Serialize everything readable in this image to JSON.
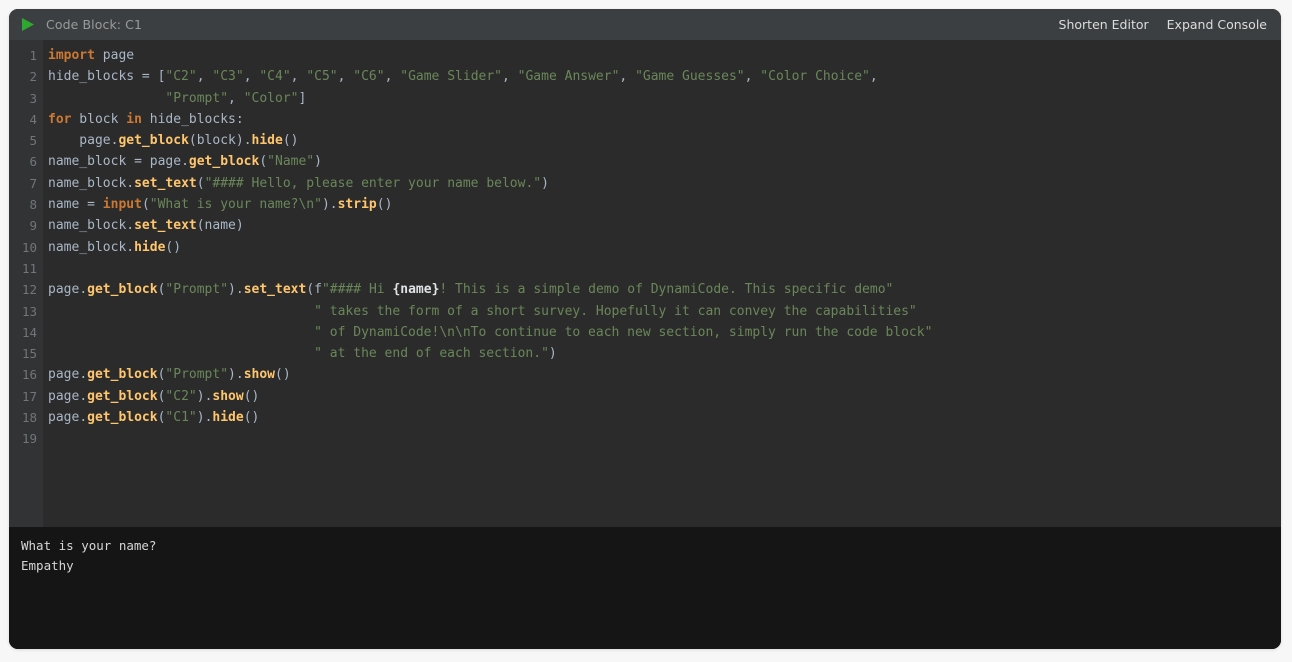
{
  "header": {
    "run_icon": "play-icon",
    "title": "Code Block: C1",
    "actions": [
      {
        "label": "Shorten Editor",
        "name": "shorten-editor-button"
      },
      {
        "label": "Expand Console",
        "name": "expand-console-button"
      }
    ]
  },
  "editor": {
    "line_numbers": [
      "1",
      "2",
      "3",
      "4",
      "5",
      "6",
      "7",
      "8",
      "9",
      "10",
      "11",
      "12",
      "13",
      "14",
      "15",
      "16",
      "17",
      "18",
      "19"
    ],
    "lines": [
      "import page",
      "hide_blocks = [\"C2\", \"C3\", \"C4\", \"C5\", \"C6\", \"Game Slider\", \"Game Answer\", \"Game Guesses\", \"Color Choice\",",
      "               \"Prompt\", \"Color\"]",
      "for block in hide_blocks:",
      "    page.get_block(block).hide()",
      "name_block = page.get_block(\"Name\")",
      "name_block.set_text(\"#### Hello, please enter your name below.\")",
      "name = input(\"What is your name?\\n\").strip()",
      "name_block.set_text(name)",
      "name_block.hide()",
      "",
      "page.get_block(\"Prompt\").set_text(f\"#### Hi {name}! This is a simple demo of DynamiCode. This specific demo\"",
      "                                  \" takes the form of a short survey. Hopefully it can convey the capabilities\"",
      "                                  \" of DynamiCode!\\n\\nTo continue to each new section, simply run the code block\"",
      "                                  \" at the end of each section.\")",
      "page.get_block(\"Prompt\").show()",
      "page.get_block(\"C2\").show()",
      "page.get_block(\"C1\").hide()",
      ""
    ],
    "tokens": [
      [
        [
          "import",
          "kw"
        ],
        [
          " ",
          "punc"
        ],
        [
          "page",
          "id"
        ]
      ],
      [
        [
          "hide_blocks",
          "id"
        ],
        [
          " = [",
          "punc"
        ],
        [
          "\"C2\"",
          "str"
        ],
        [
          ", ",
          "punc"
        ],
        [
          "\"C3\"",
          "str"
        ],
        [
          ", ",
          "punc"
        ],
        [
          "\"C4\"",
          "str"
        ],
        [
          ", ",
          "punc"
        ],
        [
          "\"C5\"",
          "str"
        ],
        [
          ", ",
          "punc"
        ],
        [
          "\"C6\"",
          "str"
        ],
        [
          ", ",
          "punc"
        ],
        [
          "\"Game Slider\"",
          "str"
        ],
        [
          ", ",
          "punc"
        ],
        [
          "\"Game Answer\"",
          "str"
        ],
        [
          ", ",
          "punc"
        ],
        [
          "\"Game Guesses\"",
          "str"
        ],
        [
          ", ",
          "punc"
        ],
        [
          "\"Color Choice\"",
          "str"
        ],
        [
          ",",
          "punc"
        ]
      ],
      [
        [
          "               ",
          "punc"
        ],
        [
          "\"Prompt\"",
          "str"
        ],
        [
          ", ",
          "punc"
        ],
        [
          "\"Color\"",
          "str"
        ],
        [
          "]",
          "punc"
        ]
      ],
      [
        [
          "for",
          "kw"
        ],
        [
          " block ",
          "id"
        ],
        [
          "in",
          "kw"
        ],
        [
          " hide_blocks:",
          "id"
        ]
      ],
      [
        [
          "    page",
          "id"
        ],
        [
          ".",
          "punc"
        ],
        [
          "get_block",
          "fn"
        ],
        [
          "(block)",
          "punc"
        ],
        [
          ".",
          "punc"
        ],
        [
          "hide",
          "fn"
        ],
        [
          "()",
          "punc"
        ]
      ],
      [
        [
          "name_block = page",
          "id"
        ],
        [
          ".",
          "punc"
        ],
        [
          "get_block",
          "fn"
        ],
        [
          "(",
          "punc"
        ],
        [
          "\"Name\"",
          "str"
        ],
        [
          ")",
          "punc"
        ]
      ],
      [
        [
          "name_block",
          "id"
        ],
        [
          ".",
          "punc"
        ],
        [
          "set_text",
          "fn"
        ],
        [
          "(",
          "punc"
        ],
        [
          "\"#### Hello, please enter your name below.\"",
          "str"
        ],
        [
          ")",
          "punc"
        ]
      ],
      [
        [
          "name = ",
          "id"
        ],
        [
          "input",
          "bi"
        ],
        [
          "(",
          "punc"
        ],
        [
          "\"What is your name?\\n\"",
          "str"
        ],
        [
          ")",
          "punc"
        ],
        [
          ".",
          "punc"
        ],
        [
          "strip",
          "fn"
        ],
        [
          "()",
          "punc"
        ]
      ],
      [
        [
          "name_block",
          "id"
        ],
        [
          ".",
          "punc"
        ],
        [
          "set_text",
          "fn"
        ],
        [
          "(name)",
          "punc"
        ]
      ],
      [
        [
          "name_block",
          "id"
        ],
        [
          ".",
          "punc"
        ],
        [
          "hide",
          "fn"
        ],
        [
          "()",
          "punc"
        ]
      ],
      [],
      [
        [
          "page",
          "id"
        ],
        [
          ".",
          "punc"
        ],
        [
          "get_block",
          "fn"
        ],
        [
          "(",
          "punc"
        ],
        [
          "\"Prompt\"",
          "str"
        ],
        [
          ")",
          "punc"
        ],
        [
          ".",
          "punc"
        ],
        [
          "set_text",
          "fn"
        ],
        [
          "(",
          "punc"
        ],
        [
          "f",
          "fpfx"
        ],
        [
          "\"#### Hi ",
          "str"
        ],
        [
          "{name}",
          "fexp"
        ],
        [
          "! This is a simple demo of DynamiCode. This specific demo\"",
          "str"
        ]
      ],
      [
        [
          "                                  ",
          "punc"
        ],
        [
          "\" takes the form of a short survey. Hopefully it can convey the capabilities\"",
          "str"
        ]
      ],
      [
        [
          "                                  ",
          "punc"
        ],
        [
          "\" of DynamiCode!\\n\\nTo continue to each new section, simply run the code block\"",
          "str"
        ]
      ],
      [
        [
          "                                  ",
          "punc"
        ],
        [
          "\" at the end of each section.\"",
          "str"
        ],
        [
          ")",
          "punc"
        ]
      ],
      [
        [
          "page",
          "id"
        ],
        [
          ".",
          "punc"
        ],
        [
          "get_block",
          "fn"
        ],
        [
          "(",
          "punc"
        ],
        [
          "\"Prompt\"",
          "str"
        ],
        [
          ")",
          "punc"
        ],
        [
          ".",
          "punc"
        ],
        [
          "show",
          "fn"
        ],
        [
          "()",
          "punc"
        ]
      ],
      [
        [
          "page",
          "id"
        ],
        [
          ".",
          "punc"
        ],
        [
          "get_block",
          "fn"
        ],
        [
          "(",
          "punc"
        ],
        [
          "\"C2\"",
          "str"
        ],
        [
          ")",
          "punc"
        ],
        [
          ".",
          "punc"
        ],
        [
          "show",
          "fn"
        ],
        [
          "()",
          "punc"
        ]
      ],
      [
        [
          "page",
          "id"
        ],
        [
          ".",
          "punc"
        ],
        [
          "get_block",
          "fn"
        ],
        [
          "(",
          "punc"
        ],
        [
          "\"C1\"",
          "str"
        ],
        [
          ")",
          "punc"
        ],
        [
          ".",
          "punc"
        ],
        [
          "hide",
          "fn"
        ],
        [
          "()",
          "punc"
        ]
      ],
      []
    ]
  },
  "console": {
    "lines": [
      "What is your name?",
      "Empathy"
    ]
  },
  "colors": {
    "page_background": "#f7f7f7",
    "header_background": "#3c3f41",
    "editor_background": "#2b2b2b",
    "gutter_background": "#313335",
    "console_background": "#151515",
    "run_icon": "#2fa82f",
    "keyword": "#cc7832",
    "function": "#ffc66d",
    "string": "#6a8759",
    "identifier": "#a9b7c6",
    "line_number": "#707679",
    "header_title": "#9a9a9a",
    "header_action": "#dcdcdc",
    "console_text": "#d6d6d6"
  }
}
